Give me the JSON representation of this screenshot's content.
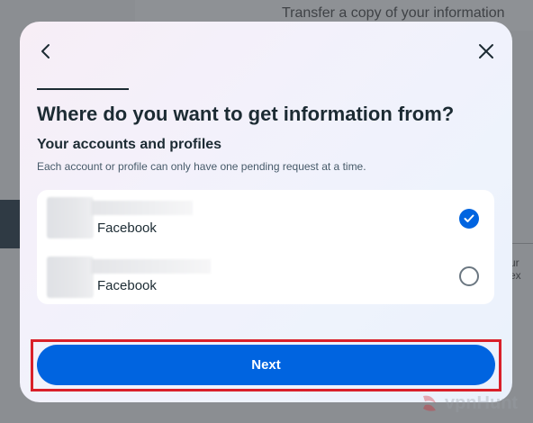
{
  "background": {
    "title": "Transfer a copy of your information",
    "right_text": "ur ex"
  },
  "modal": {
    "back_label": "Back",
    "close_label": "Close",
    "heading": "Where do you want to get information from?",
    "subheading": "Your accounts and profiles",
    "description": "Each account or profile can only have one pending request at a time.",
    "accounts": [
      {
        "label": "Facebook",
        "selected": true
      },
      {
        "label": "Facebook",
        "selected": false
      }
    ],
    "next_label": "Next"
  },
  "watermark": {
    "text": "vpnHunt"
  },
  "colors": {
    "accent": "#0064e0",
    "highlight": "#d9202a",
    "text_primary": "#1c2b33"
  }
}
